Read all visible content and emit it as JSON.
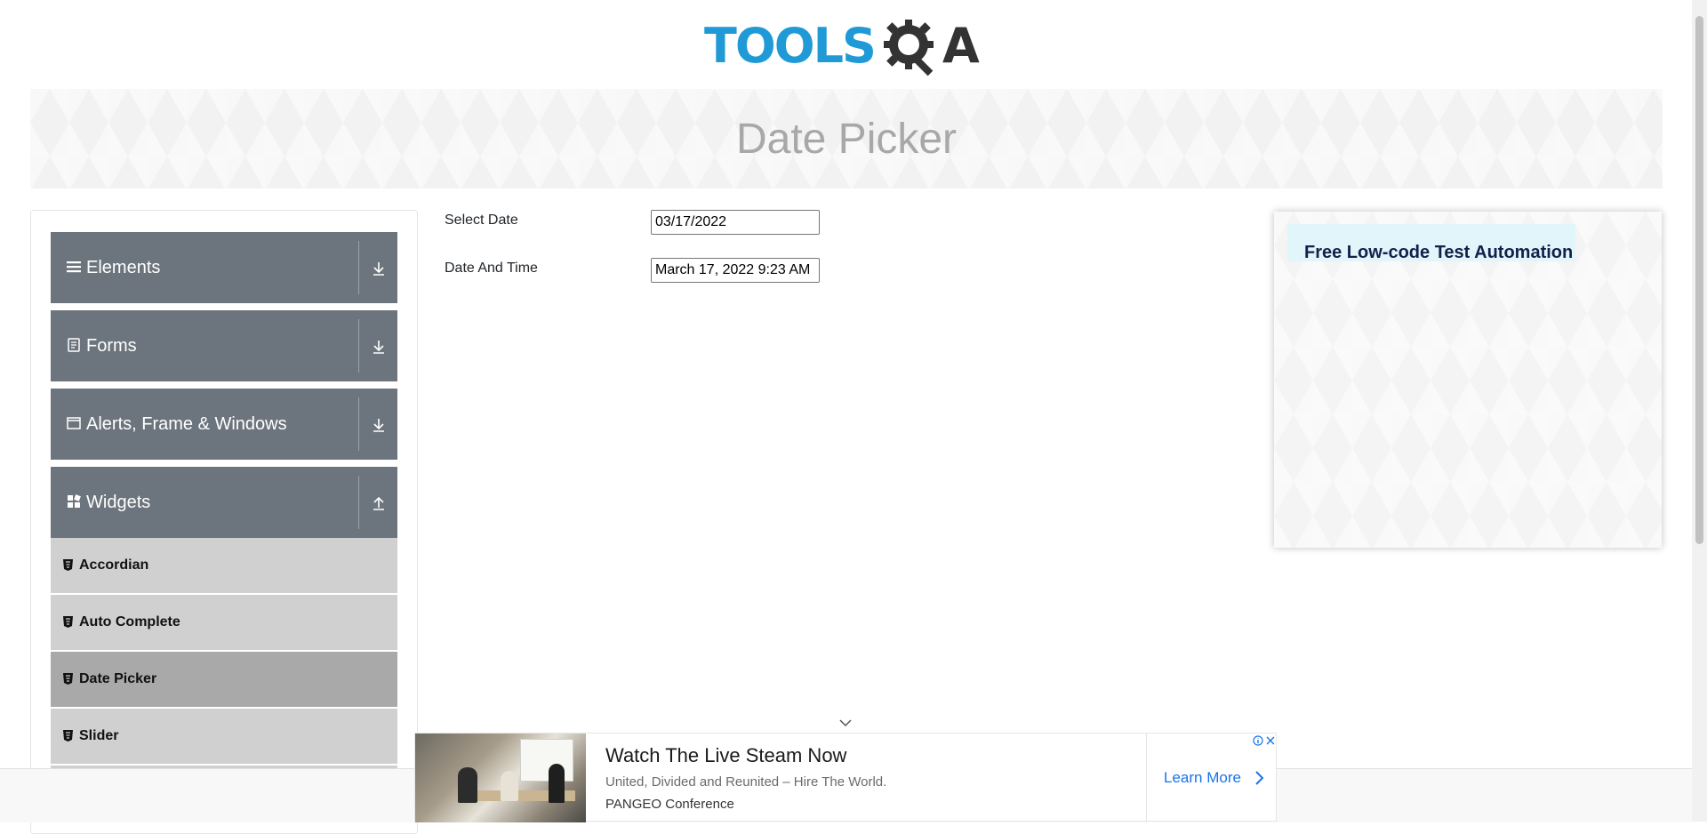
{
  "header": {
    "logo_text_tools": "TOOLS",
    "logo_text_qa": "A"
  },
  "banner": {
    "title": "Date Picker"
  },
  "sidebar": {
    "groups": [
      {
        "label": "Elements",
        "icon": "hamburger-icon",
        "expanded": false
      },
      {
        "label": "Forms",
        "icon": "document-icon",
        "expanded": false
      },
      {
        "label": "Alerts, Frame & Windows",
        "icon": "window-icon",
        "expanded": false
      },
      {
        "label": "Widgets",
        "icon": "widgets-icon",
        "expanded": true
      }
    ],
    "widget_items": [
      {
        "label": "Accordian",
        "active": false
      },
      {
        "label": "Auto Complete",
        "active": false
      },
      {
        "label": "Date Picker",
        "active": true
      },
      {
        "label": "Slider",
        "active": false
      }
    ]
  },
  "form": {
    "select_date_label": "Select Date",
    "select_date_value": "03/17/2022",
    "date_time_label": "Date And Time",
    "date_time_value": "March 17, 2022 9:23 AM"
  },
  "side_ad": {
    "headline": "Free Low-code Test Automation"
  },
  "bottom_ad": {
    "headline": "Watch The Live Steam Now",
    "description": "United, Divided and Reunited – Hire The World.",
    "brand": "PANGEO Conference",
    "cta": "Learn More"
  },
  "colors": {
    "brand_blue": "#1f9ad6",
    "sidebar_group_bg": "#6c757d",
    "sidebar_item_bg": "#d0d0d0",
    "sidebar_item_active_bg": "#a9a9a9",
    "link_blue": "#1a73e8"
  }
}
